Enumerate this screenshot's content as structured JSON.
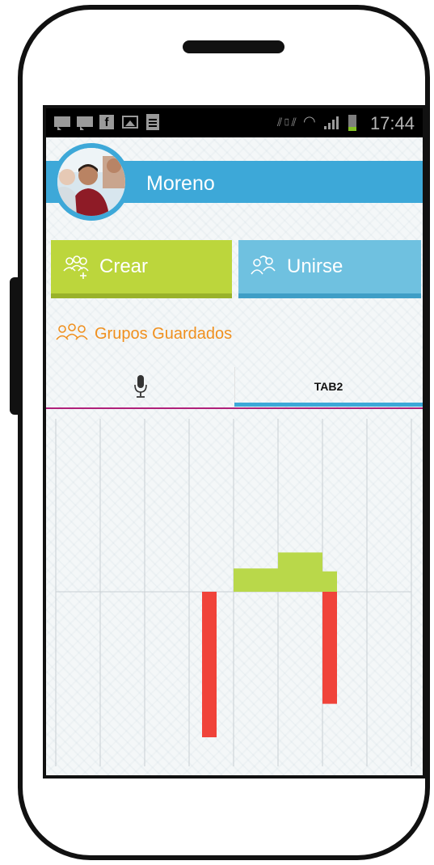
{
  "status_bar": {
    "time": "17:44",
    "left_icons": [
      "notification-icon",
      "notification-icon",
      "facebook-icon",
      "gallery-icon",
      "document-icon"
    ],
    "right_icons": [
      "vibrate-icon",
      "wifi-icon",
      "signal-icon",
      "battery-icon"
    ]
  },
  "profile": {
    "name": "Moreno",
    "accent": "#3da8d8"
  },
  "actions": {
    "crear": {
      "label": "Crear",
      "color": "#bcd63c"
    },
    "unirse": {
      "label": "Unirse",
      "color": "#6fc1e0"
    }
  },
  "saved_groups": {
    "label": "Grupos Guardados",
    "color": "#f0901e"
  },
  "tabs": [
    {
      "icon": "microphone-icon",
      "label": "",
      "selected": false
    },
    {
      "label": "TAB2",
      "selected": true
    }
  ],
  "chart_data": {
    "type": "bar",
    "columns": 8,
    "baseline_marked": true,
    "bars": [
      {
        "column": 4,
        "value": -10.0,
        "color": "#f0433a"
      },
      {
        "column": 5,
        "value": 1.6,
        "color": "#b9d84a"
      },
      {
        "column": 6,
        "value": 2.7,
        "color": "#b9d84a"
      },
      {
        "column": 7,
        "value": -7.7,
        "color": "#f0433a"
      },
      {
        "column": 7,
        "value": 1.4,
        "color": "#b9d84a"
      }
    ],
    "colors": {
      "positive": "#b9d84a",
      "negative": "#f0433a"
    }
  }
}
